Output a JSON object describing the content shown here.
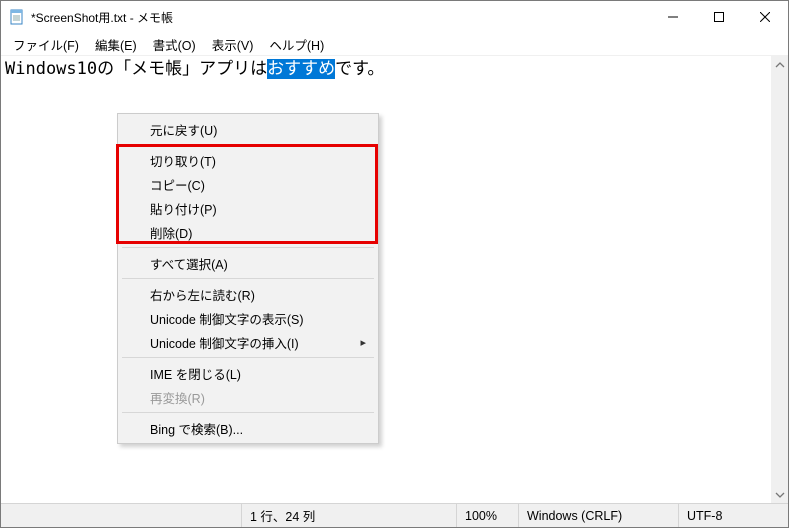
{
  "title": "*ScreenShot用.txt - メモ帳",
  "menubar": {
    "file": "ファイル(F)",
    "edit": "編集(E)",
    "format": "書式(O)",
    "view": "表示(V)",
    "help": "ヘルプ(H)"
  },
  "editor": {
    "prefix": "Windows10の「メモ帳」アプリは",
    "selected": "おすすめ",
    "suffix": "です。"
  },
  "context_menu": {
    "undo": "元に戻す(U)",
    "cut": "切り取り(T)",
    "copy": "コピー(C)",
    "paste": "貼り付け(P)",
    "delete": "削除(D)",
    "select_all": "すべて選択(A)",
    "rtl": "右から左に読む(R)",
    "uni_show": "Unicode 制御文字の表示(S)",
    "uni_insert": "Unicode 制御文字の挿入(I)",
    "ime_close": "IME を閉じる(L)",
    "reconvert": "再変換(R)",
    "bing": "Bing で検索(B)..."
  },
  "statusbar": {
    "position": "1 行、24 列",
    "zoom": "100%",
    "eol": "Windows (CRLF)",
    "encoding": "UTF-8"
  }
}
